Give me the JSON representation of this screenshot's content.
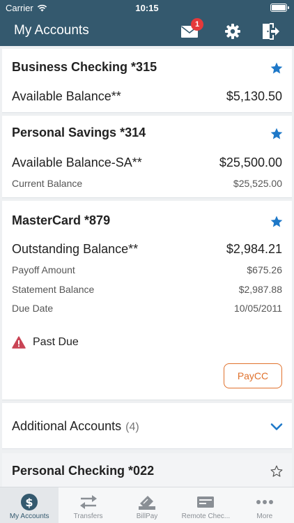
{
  "status_bar": {
    "carrier": "Carrier",
    "time": "10:15"
  },
  "header": {
    "title": "My Accounts",
    "mail_badge": "1"
  },
  "colors": {
    "header_bg": "#34596e",
    "accent_blue": "#1e78c8",
    "paycc_orange": "#e0712c",
    "alert_red": "#c94455"
  },
  "accounts": [
    {
      "name": "Business Checking *315",
      "favorite": true,
      "primary": {
        "label": "Available Balance**",
        "value": "$5,130.50"
      },
      "details": []
    },
    {
      "name": "Personal Savings *314",
      "favorite": true,
      "primary": {
        "label": "Available Balance-SA**",
        "value": "$25,500.00"
      },
      "details": [
        {
          "label": "Current Balance",
          "value": "$25,525.00"
        }
      ]
    },
    {
      "name": "MasterCard *879",
      "favorite": true,
      "primary": {
        "label": "Outstanding Balance**",
        "value": "$2,984.21"
      },
      "details": [
        {
          "label": "Payoff Amount",
          "value": "$675.26"
        },
        {
          "label": "Statement Balance",
          "value": "$2,987.88"
        },
        {
          "label": "Due Date",
          "value": "10/05/2011"
        }
      ],
      "alert": "Past Due",
      "action_label": "PayCC"
    }
  ],
  "additional_accounts": {
    "label": "Additional Accounts",
    "count": "(4)"
  },
  "partial_account": {
    "name": "Personal Checking *022",
    "favorite": false
  },
  "tabs": [
    {
      "label": "My Accounts",
      "icon": "dollar-icon",
      "active": true
    },
    {
      "label": "Transfers",
      "icon": "transfer-arrows-icon",
      "active": false
    },
    {
      "label": "BillPay",
      "icon": "bill-icon",
      "active": false
    },
    {
      "label": "Remote Chec...",
      "icon": "check-deposit-icon",
      "active": false
    },
    {
      "label": "More",
      "icon": "more-dots-icon",
      "active": false
    }
  ]
}
